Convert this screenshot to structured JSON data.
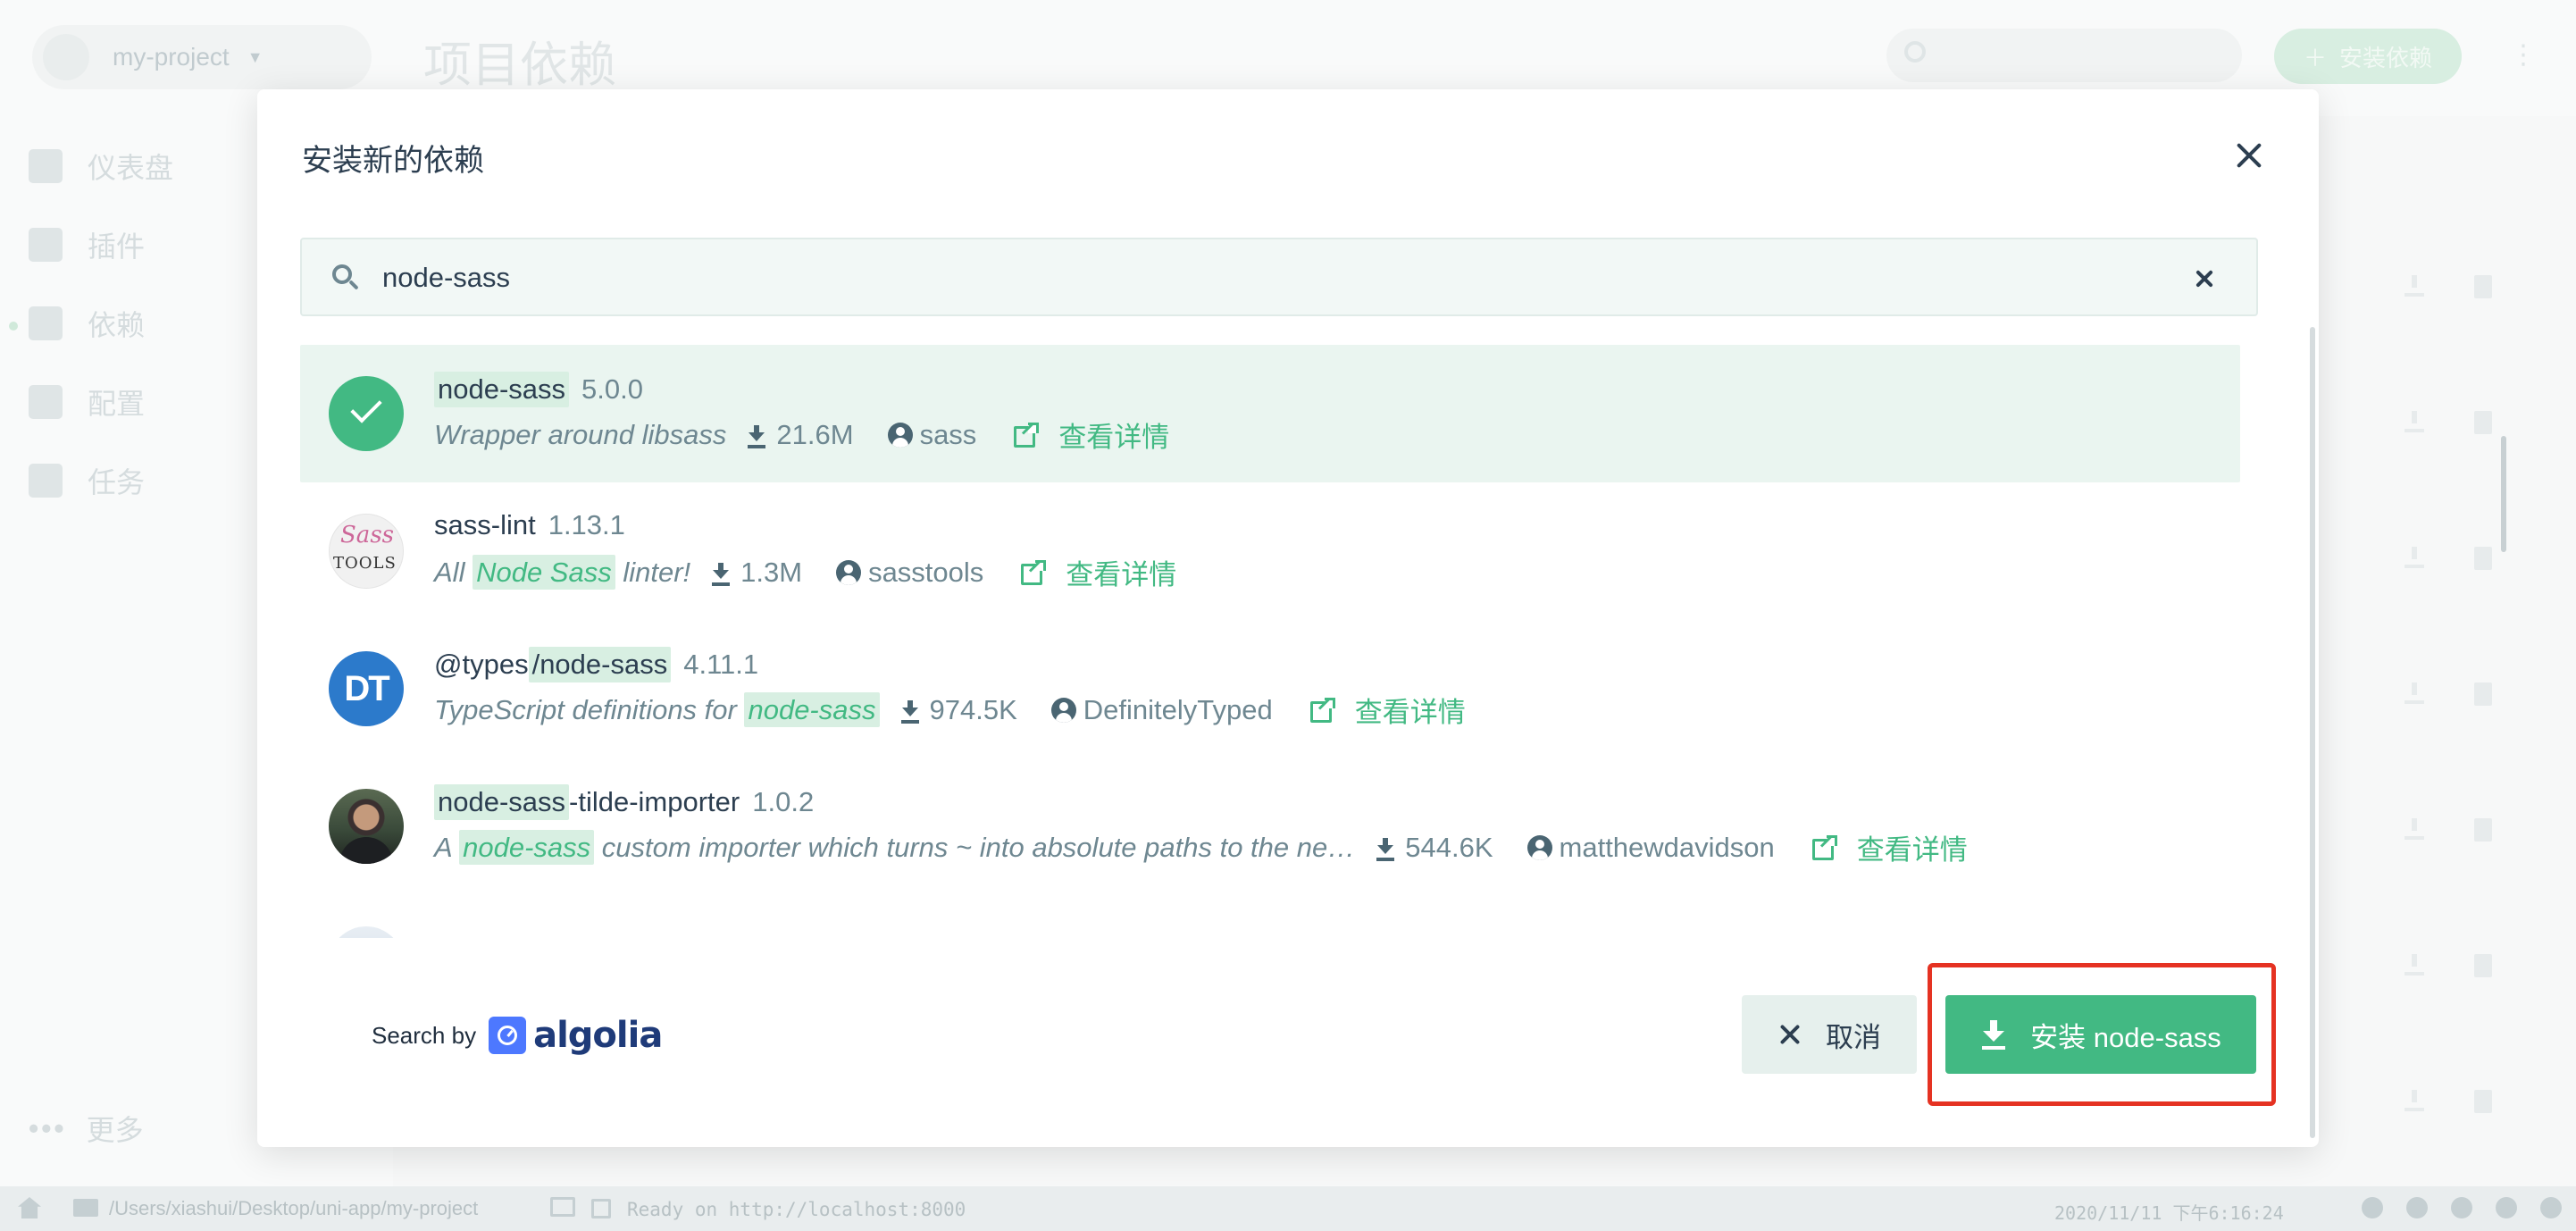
{
  "app": {
    "project_name": "my-project",
    "page_title": "项目依赖",
    "add_dependency_label": "安装依赖",
    "sidebar": {
      "items": [
        {
          "label": "仪表盘",
          "icon": "dashboard-icon"
        },
        {
          "label": "插件",
          "icon": "puzzle-icon"
        },
        {
          "label": "依赖",
          "icon": "library-icon",
          "active": true
        },
        {
          "label": "配置",
          "icon": "settings-icon"
        },
        {
          "label": "任务",
          "icon": "clipboard-icon"
        }
      ],
      "more_label": "更多"
    }
  },
  "modal": {
    "title": "安装新的依赖",
    "search": {
      "value": "node-sass",
      "placeholder": ""
    },
    "results": [
      {
        "name_parts": [
          {
            "text": "node-sass",
            "hl": true
          }
        ],
        "version": "5.0.0",
        "description_parts": [
          {
            "text": "Wrapper around libsass",
            "hl": false
          }
        ],
        "downloads": "21.6M",
        "author": "sass",
        "details_label": "查看详情",
        "avatar": "installed-check-icon",
        "selected": true
      },
      {
        "name_parts": [
          {
            "text": "sass-lint",
            "hl": false
          }
        ],
        "version": "1.13.1",
        "description_parts": [
          {
            "text": "All ",
            "hl": false
          },
          {
            "text": "Node Sass",
            "hl": true
          },
          {
            "text": " linter!",
            "hl": false
          }
        ],
        "downloads": "1.3M",
        "author": "sasstools",
        "details_label": "查看详情",
        "avatar": "sass-tools-logo",
        "avatar_text_top": "Sass",
        "avatar_text_bottom": "TOOLS"
      },
      {
        "name_parts": [
          {
            "text": "@types",
            "hl": false
          },
          {
            "text": "/node-sass",
            "hl": true
          }
        ],
        "version": "4.11.1",
        "description_parts": [
          {
            "text": "TypeScript definitions for ",
            "hl": false
          },
          {
            "text": "node-sass",
            "hl": true
          }
        ],
        "downloads": "974.5K",
        "author": "DefinitelyTyped",
        "details_label": "查看详情",
        "avatar": "definitelytyped-logo",
        "avatar_text": "DT"
      },
      {
        "name_parts": [
          {
            "text": "node-sass",
            "hl": true
          },
          {
            "text": "-tilde-importer",
            "hl": false
          }
        ],
        "version": "1.0.2",
        "description_parts": [
          {
            "text": "A ",
            "hl": false
          },
          {
            "text": "node-sass",
            "hl": true
          },
          {
            "text": " custom importer which turns ~ into absolute paths to the ne…",
            "hl": false
          }
        ],
        "downloads": "544.6K",
        "author": "matthewdavidson",
        "details_label": "查看详情",
        "avatar": "user-photo"
      },
      {
        "name_parts": [
          {
            "text": "",
            "hl": false
          }
        ],
        "version": "",
        "description_parts": [],
        "downloads": "",
        "author": "",
        "details_label": "",
        "avatar": "partial-avatar"
      }
    ],
    "search_by_label": "Search by",
    "algolia_label": "algolia",
    "cancel_label": "取消",
    "install_label": "安装 node-sass"
  },
  "statusbar": {
    "path": "/Users/xiashui/Desktop/uni-app/my-project",
    "log": "Ready on http://localhost:8000",
    "time": "2020/11/11 下午6:16:24"
  },
  "colors": {
    "accent": "#42b983",
    "highlight_bg": "#d8efe2",
    "annotation_frame": "#e53222"
  }
}
